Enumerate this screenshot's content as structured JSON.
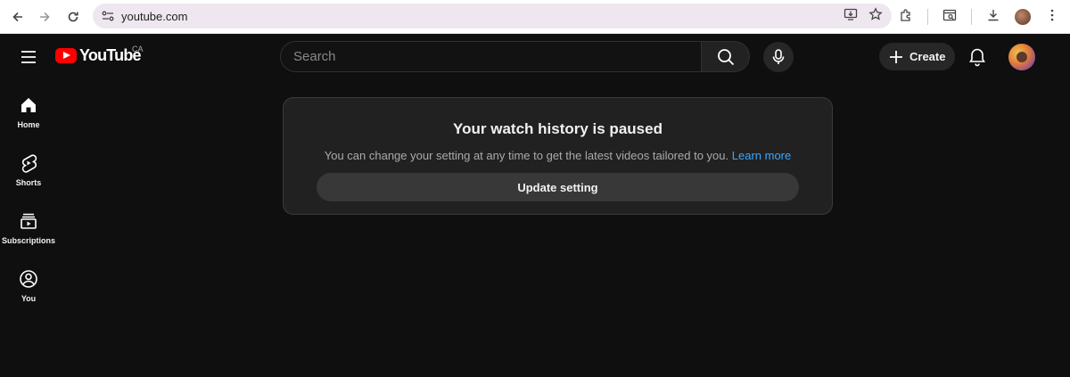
{
  "browser": {
    "url": "youtube.com",
    "icons": [
      "back-icon",
      "forward-icon",
      "reload-icon",
      "site-info-icon",
      "install-app-icon",
      "bookmark-star-icon",
      "extensions-icon",
      "tab-search-icon",
      "download-icon",
      "profile-icon",
      "more-icon"
    ]
  },
  "masthead": {
    "logo_text": "YouTube",
    "country_code": "CA",
    "search_placeholder": "Search",
    "search_value": "",
    "create_label": "Create"
  },
  "guide": {
    "items": [
      {
        "label": "Home",
        "icon": "home-icon"
      },
      {
        "label": "Shorts",
        "icon": "shorts-icon"
      },
      {
        "label": "Subscriptions",
        "icon": "subscriptions-icon"
      },
      {
        "label": "You",
        "icon": "you-icon"
      }
    ]
  },
  "message": {
    "title": "Your watch history is paused",
    "description": "You can change your setting at any time to get the latest videos tailored to you.",
    "link_label": "Learn more",
    "button_label": "Update setting"
  },
  "colors": {
    "background": "#0f0f0f",
    "card": "#212121",
    "accent_red": "#ff0000",
    "link": "#3ea6ff",
    "omnibox": "#efe7f0"
  }
}
